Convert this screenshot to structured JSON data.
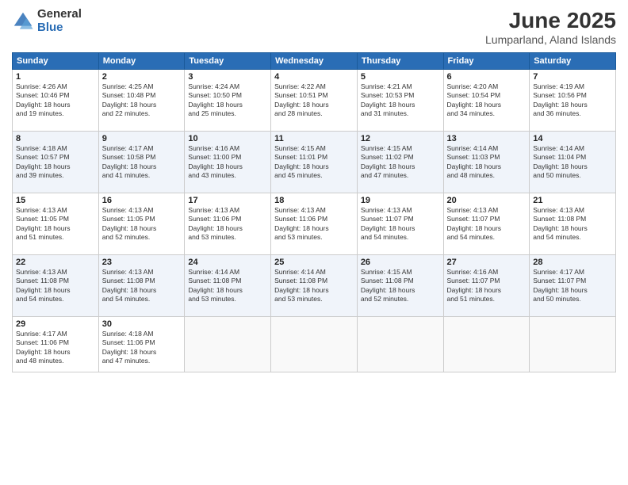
{
  "logo": {
    "general": "General",
    "blue": "Blue"
  },
  "title": "June 2025",
  "location": "Lumparland, Aland Islands",
  "days_header": [
    "Sunday",
    "Monday",
    "Tuesday",
    "Wednesday",
    "Thursday",
    "Friday",
    "Saturday"
  ],
  "weeks": [
    [
      {
        "day": "1",
        "info": "Sunrise: 4:26 AM\nSunset: 10:46 PM\nDaylight: 18 hours\nand 19 minutes."
      },
      {
        "day": "2",
        "info": "Sunrise: 4:25 AM\nSunset: 10:48 PM\nDaylight: 18 hours\nand 22 minutes."
      },
      {
        "day": "3",
        "info": "Sunrise: 4:24 AM\nSunset: 10:50 PM\nDaylight: 18 hours\nand 25 minutes."
      },
      {
        "day": "4",
        "info": "Sunrise: 4:22 AM\nSunset: 10:51 PM\nDaylight: 18 hours\nand 28 minutes."
      },
      {
        "day": "5",
        "info": "Sunrise: 4:21 AM\nSunset: 10:53 PM\nDaylight: 18 hours\nand 31 minutes."
      },
      {
        "day": "6",
        "info": "Sunrise: 4:20 AM\nSunset: 10:54 PM\nDaylight: 18 hours\nand 34 minutes."
      },
      {
        "day": "7",
        "info": "Sunrise: 4:19 AM\nSunset: 10:56 PM\nDaylight: 18 hours\nand 36 minutes."
      }
    ],
    [
      {
        "day": "8",
        "info": "Sunrise: 4:18 AM\nSunset: 10:57 PM\nDaylight: 18 hours\nand 39 minutes."
      },
      {
        "day": "9",
        "info": "Sunrise: 4:17 AM\nSunset: 10:58 PM\nDaylight: 18 hours\nand 41 minutes."
      },
      {
        "day": "10",
        "info": "Sunrise: 4:16 AM\nSunset: 11:00 PM\nDaylight: 18 hours\nand 43 minutes."
      },
      {
        "day": "11",
        "info": "Sunrise: 4:15 AM\nSunset: 11:01 PM\nDaylight: 18 hours\nand 45 minutes."
      },
      {
        "day": "12",
        "info": "Sunrise: 4:15 AM\nSunset: 11:02 PM\nDaylight: 18 hours\nand 47 minutes."
      },
      {
        "day": "13",
        "info": "Sunrise: 4:14 AM\nSunset: 11:03 PM\nDaylight: 18 hours\nand 48 minutes."
      },
      {
        "day": "14",
        "info": "Sunrise: 4:14 AM\nSunset: 11:04 PM\nDaylight: 18 hours\nand 50 minutes."
      }
    ],
    [
      {
        "day": "15",
        "info": "Sunrise: 4:13 AM\nSunset: 11:05 PM\nDaylight: 18 hours\nand 51 minutes."
      },
      {
        "day": "16",
        "info": "Sunrise: 4:13 AM\nSunset: 11:05 PM\nDaylight: 18 hours\nand 52 minutes."
      },
      {
        "day": "17",
        "info": "Sunrise: 4:13 AM\nSunset: 11:06 PM\nDaylight: 18 hours\nand 53 minutes."
      },
      {
        "day": "18",
        "info": "Sunrise: 4:13 AM\nSunset: 11:06 PM\nDaylight: 18 hours\nand 53 minutes."
      },
      {
        "day": "19",
        "info": "Sunrise: 4:13 AM\nSunset: 11:07 PM\nDaylight: 18 hours\nand 54 minutes."
      },
      {
        "day": "20",
        "info": "Sunrise: 4:13 AM\nSunset: 11:07 PM\nDaylight: 18 hours\nand 54 minutes."
      },
      {
        "day": "21",
        "info": "Sunrise: 4:13 AM\nSunset: 11:08 PM\nDaylight: 18 hours\nand 54 minutes."
      }
    ],
    [
      {
        "day": "22",
        "info": "Sunrise: 4:13 AM\nSunset: 11:08 PM\nDaylight: 18 hours\nand 54 minutes."
      },
      {
        "day": "23",
        "info": "Sunrise: 4:13 AM\nSunset: 11:08 PM\nDaylight: 18 hours\nand 54 minutes."
      },
      {
        "day": "24",
        "info": "Sunrise: 4:14 AM\nSunset: 11:08 PM\nDaylight: 18 hours\nand 53 minutes."
      },
      {
        "day": "25",
        "info": "Sunrise: 4:14 AM\nSunset: 11:08 PM\nDaylight: 18 hours\nand 53 minutes."
      },
      {
        "day": "26",
        "info": "Sunrise: 4:15 AM\nSunset: 11:08 PM\nDaylight: 18 hours\nand 52 minutes."
      },
      {
        "day": "27",
        "info": "Sunrise: 4:16 AM\nSunset: 11:07 PM\nDaylight: 18 hours\nand 51 minutes."
      },
      {
        "day": "28",
        "info": "Sunrise: 4:17 AM\nSunset: 11:07 PM\nDaylight: 18 hours\nand 50 minutes."
      }
    ],
    [
      {
        "day": "29",
        "info": "Sunrise: 4:17 AM\nSunset: 11:06 PM\nDaylight: 18 hours\nand 48 minutes."
      },
      {
        "day": "30",
        "info": "Sunrise: 4:18 AM\nSunset: 11:06 PM\nDaylight: 18 hours\nand 47 minutes."
      },
      {
        "day": "",
        "info": ""
      },
      {
        "day": "",
        "info": ""
      },
      {
        "day": "",
        "info": ""
      },
      {
        "day": "",
        "info": ""
      },
      {
        "day": "",
        "info": ""
      }
    ]
  ]
}
